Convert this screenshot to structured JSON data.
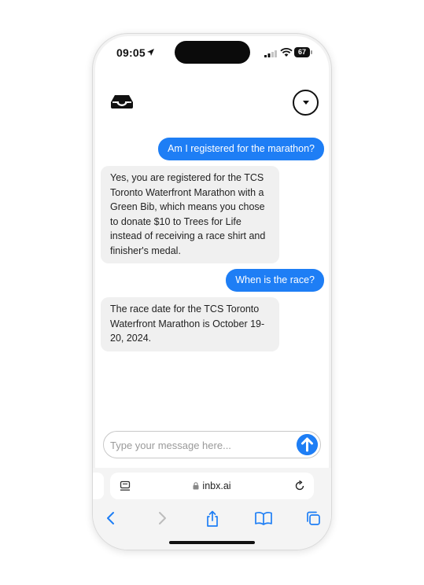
{
  "status_bar": {
    "time": "09:05",
    "battery": "67",
    "icons": [
      "location-arrow-icon",
      "signal-icon",
      "wifi-icon",
      "battery-icon"
    ]
  },
  "header": {
    "icons": [
      "inbox-icon",
      "dropdown-menu-icon"
    ]
  },
  "messages": [
    {
      "role": "user",
      "text": "Am I registered for the marathon?"
    },
    {
      "role": "assistant",
      "text": "Yes, you are registered for the TCS\nToronto Waterfront Marathon with a\nGreen Bib, which means you chose\nto donate $10 to Trees for Life\ninstead of receiving a race shirt and\nfinisher's medal."
    },
    {
      "role": "user",
      "text": "When is the race?"
    },
    {
      "role": "assistant",
      "text": "The race date for the TCS Toronto\nWaterfront Marathon is October 19-\n20, 2024."
    }
  ],
  "composer": {
    "placeholder": "Type your message here...",
    "value": "",
    "send_icon": "arrow-up-icon"
  },
  "browser": {
    "url": "inbx.ai",
    "toolbar_icons": [
      "back-icon",
      "forward-icon",
      "share-icon",
      "bookmarks-icon",
      "tabs-icon"
    ]
  },
  "colors": {
    "accent": "#1e7ef5",
    "bot_bubble": "#f0f0f0",
    "text": "#222222"
  }
}
